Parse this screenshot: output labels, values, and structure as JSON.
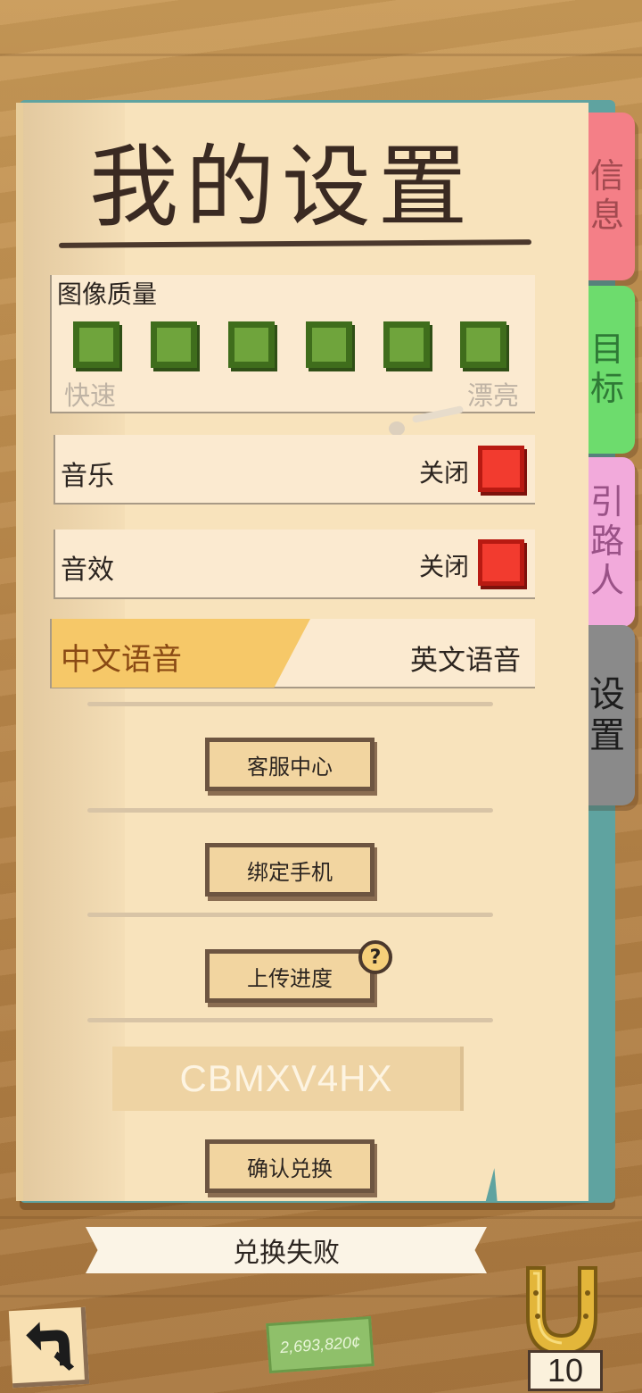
{
  "page": {
    "title": "我的设置"
  },
  "tabs": {
    "info": "信息",
    "goal": "目标",
    "guide": "引路人",
    "settings": "设置"
  },
  "quality": {
    "label": "图像质量",
    "min_label": "快速",
    "max_label": "漂亮",
    "levels": 6
  },
  "music": {
    "label": "音乐",
    "state": "关闭"
  },
  "sfx": {
    "label": "音效",
    "state": "关闭"
  },
  "language": {
    "chinese": "中文语音",
    "english": "英文语音",
    "selected": "中文语音"
  },
  "buttons": {
    "support": "客服中心",
    "bind_phone": "绑定手机",
    "upload_progress": "上传进度",
    "confirm_redeem": "确认兑换"
  },
  "help_icon": "?",
  "redeem": {
    "code": "CBMXV4HX",
    "result": "兑换失败"
  },
  "footer": {
    "money": "2,693,820¢",
    "horseshoe_count": "10"
  },
  "icons": {
    "back": "back-arrow-icon",
    "help": "question-icon",
    "horseshoe": "horseshoe-icon",
    "money": "banknote-icon"
  },
  "colors": {
    "paper": "#f8e3bc",
    "tab_info": "#f47f87",
    "tab_goal": "#6ddc6d",
    "tab_guide": "#f2aadb",
    "tab_settings": "#8a8a8a",
    "quality_box": "#6fa43c",
    "toggle_off": "#f23b2f",
    "language_selected": "#f6c868"
  }
}
